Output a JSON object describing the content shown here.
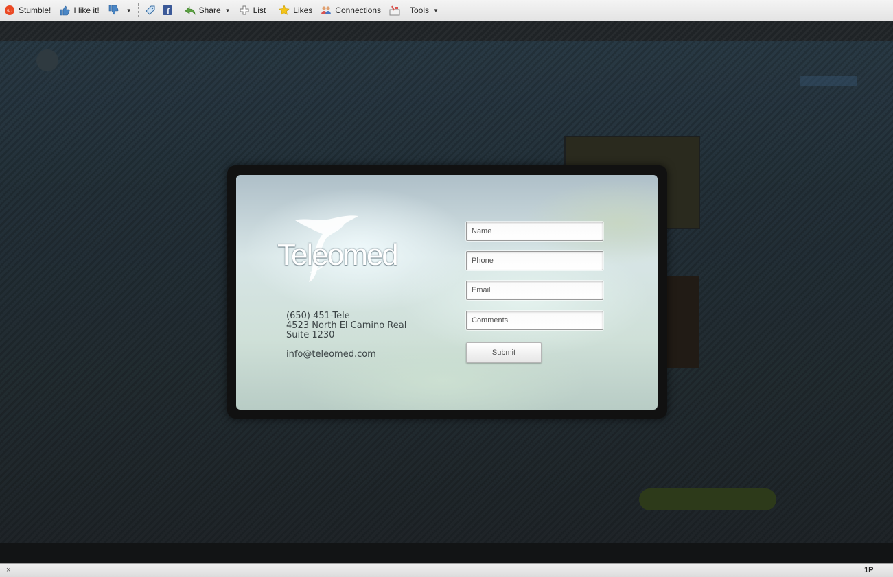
{
  "toolbar": {
    "items": [
      {
        "label": "Stumble!",
        "icon": "stumbleupon-icon"
      },
      {
        "label": "I like it!",
        "icon": "thumbs-up-icon"
      },
      {
        "label": "",
        "icon": "thumbs-down-icon"
      },
      {
        "label": "",
        "icon": "tag-icon"
      },
      {
        "label": "",
        "icon": "facebook-icon"
      },
      {
        "label": "Share",
        "icon": "share-icon"
      },
      {
        "label": "List",
        "icon": "plus-icon"
      },
      {
        "label": "Likes",
        "icon": "star-icon"
      },
      {
        "label": "Connections",
        "icon": "people-icon"
      },
      {
        "label": "Tools",
        "icon": "tools-icon"
      }
    ]
  },
  "modal": {
    "logo_text": "Teleomed",
    "contact": {
      "phone": "(650) 451-Tele",
      "address_line1": "4523 North El Camino Real",
      "address_line2": "Suite 1230",
      "email": "info@teleomed.com"
    },
    "form": {
      "name_placeholder": "Name",
      "phone_placeholder": "Phone",
      "email_placeholder": "Email",
      "comments_placeholder": "Comments",
      "submit_label": "Submit"
    }
  },
  "statusbar": {
    "close_symbol": "×",
    "right_label": "1P"
  },
  "colors": {
    "toolbar_bg": "#e9e9e9",
    "overlay_bg": "#1f2326",
    "modal_frame": "#111111",
    "contact_text": "#3c4446"
  }
}
